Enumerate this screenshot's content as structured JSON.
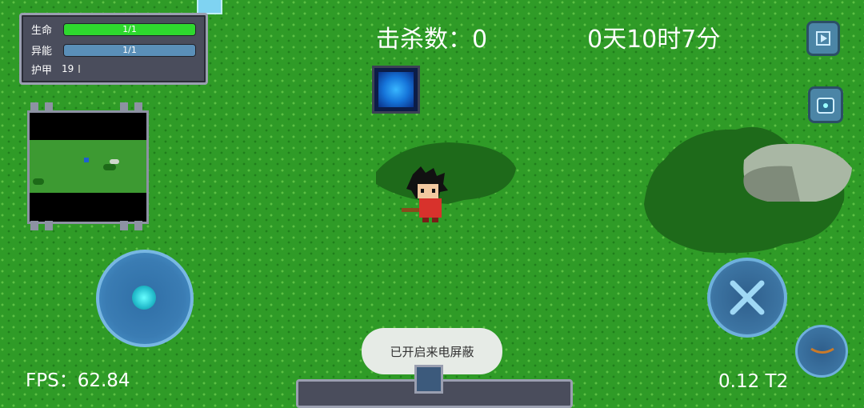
{
  "status": {
    "hp_label": "生命",
    "hp_value": "1/1",
    "hp_fill": 1.0,
    "energy_label": "异能",
    "energy_value": "1/1",
    "energy_fill": 1.0,
    "armor_label": "护甲",
    "armor_value": "19"
  },
  "hud": {
    "kills": "击杀数：0",
    "clock": "0天10时7分",
    "fps": "FPS：62.84",
    "version": "0.12 T2"
  },
  "toast": {
    "text": "已开启来电屏蔽"
  },
  "icons": {
    "play": "play-icon",
    "backpack": "backpack-icon",
    "attack": "crossed-swords-icon",
    "skill": "bow-icon",
    "portal": "portal-icon",
    "crystal": "crystal-icon"
  },
  "colors": {
    "grass": "#2f9b27",
    "hp_bar": "#2ed82e",
    "energy_bar": "#5a8fb8",
    "panel": "#4a4d5c",
    "button_blue": "#3c74a2"
  }
}
